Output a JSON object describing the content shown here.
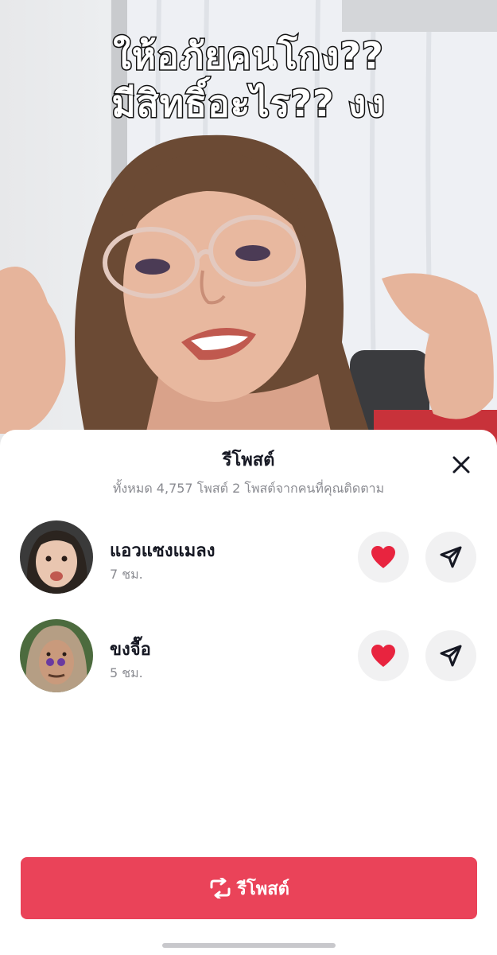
{
  "video": {
    "caption_lines": [
      "ให้อภัยคนโกง??",
      "มีสิทธิ์อะไร?? งง"
    ]
  },
  "sheet": {
    "title": "รีโพสต์",
    "subtitle": "ทั้งหมด 4,757 โพสต์ 2 โพสต์จากคนที่คุณติดตาม",
    "close_icon": "close-icon",
    "users": [
      {
        "name": "แอวแซงแมลง",
        "time": "7 ชม.",
        "like_icon": "heart-icon",
        "send_icon": "send-icon"
      },
      {
        "name": "ขงจื๊อ",
        "time": "5 ชม.",
        "like_icon": "heart-icon",
        "send_icon": "send-icon"
      }
    ],
    "repost_button": {
      "label": "รีโพสต์",
      "icon": "repost-icon"
    }
  },
  "colors": {
    "accent": "#ea4359",
    "heart": "#e8243f",
    "text_primary": "#161823",
    "text_secondary": "#8a8b91"
  }
}
